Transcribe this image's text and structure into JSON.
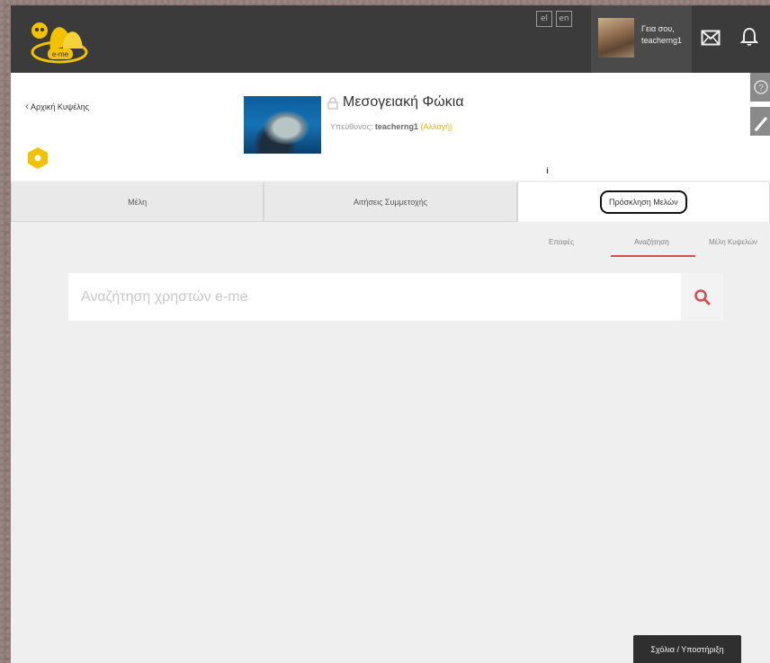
{
  "topbar": {
    "logo_text": "e-me",
    "lang_icons": [
      "el",
      "en"
    ],
    "user": {
      "name_line1": "Γεια σου,",
      "name_line2": "teacherng1"
    },
    "mail_icon": "mail-icon",
    "bell_icon": "bell-icon"
  },
  "header": {
    "back_label": "Αρχική Κυψέλης",
    "group_title": "Μεσογειακή Φώκια",
    "owner_prefix": "Υπεύθυνος: ",
    "owner_name": "teacherng1",
    "owner_change": "(Αλλαγή)",
    "photo_info": "i"
  },
  "tabs": [
    {
      "label": "Μέλη",
      "active": false
    },
    {
      "label": "Αιτήσεις Συμμετοχής",
      "active": false
    },
    {
      "label": "Πρόσκληση Μελών",
      "active": true
    }
  ],
  "subtabs": [
    {
      "label": "Επαφές",
      "active": false
    },
    {
      "label": "Αναζήτηση",
      "active": true
    },
    {
      "label": "Μέλη Κυψελών",
      "active": false
    }
  ],
  "search": {
    "placeholder": "Αναζήτηση χρηστών e-me",
    "value": ""
  },
  "footer": {
    "help_label": "Σχόλια / Υποστήριξη"
  },
  "colors": {
    "topbar": "#3b3b3b",
    "accent_red": "#d45050",
    "accent_yellow": "#f2c200"
  }
}
